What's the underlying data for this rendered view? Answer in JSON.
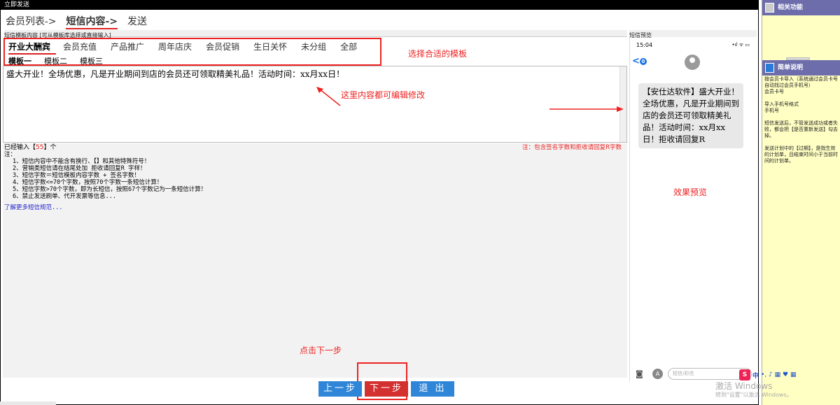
{
  "window": {
    "title": "立即发送"
  },
  "steps": [
    {
      "label": "会员列表->"
    },
    {
      "label": "短信内容->"
    },
    {
      "label": "发送"
    }
  ],
  "template_section": {
    "label": "短信模板内容   [可从模板库选择或直接输入]",
    "categories": [
      "开业大酬宾",
      "会员充值",
      "产品推广",
      "周年店庆",
      "会员促销",
      "生日关怀",
      "未分组",
      "全部"
    ],
    "subtabs": [
      "模板一",
      "模板二",
      "模板三"
    ],
    "annotation": "选择合适的模板"
  },
  "editor": {
    "content": "盛大开业！全场优惠，凡是开业期间到店的会员还可领取精美礼品！活动时间：xx月xx日！",
    "annotation": "这里内容都可编辑修改"
  },
  "notes": {
    "count_prefix": "已经输入【",
    "count_value": "55",
    "count_suffix": "】个",
    "hint": "注：包含签名字数和拒收请回复R字数",
    "title": "注：",
    "rules": [
      "1、短信内容中不能含有换行、【】和其他特殊符号！",
      "2、营销类短信请在结尾处加 拒收请回复R 字样！",
      "3、短信字数＝短信模板内容字数 + 签名字数！",
      "4、短信字数<=70个字数，按照70个字数一条短信计算！",
      "5、短信字数>70个字数，即为长短信，按照67个字数记为一条短信计算！",
      "6、禁止发送刷单、代开发票等信息..."
    ],
    "link": "了解更多短信规范..."
  },
  "preview": {
    "label": "短信预览",
    "time": "15:04",
    "status": "•ıl ᯤ ▭",
    "back": "<",
    "back_badge": "0",
    "message": "【安仕达软件】盛大开业！全场优惠，凡是开业期间到店的会员还可领取精美礼品！活动时间：xx月xx日！拒收请回复R",
    "annotation": "效果预览",
    "input_placeholder": "短信/彩信"
  },
  "footer_annotation": "点击下一步",
  "buttons": {
    "prev": "上一步",
    "next": "下一步",
    "exit": "退 出"
  },
  "right_panel": {
    "related_title": "相关功能",
    "help_title": "简单说明",
    "help_text": "按会员卡导入（系统通过会员卡号自动找过会员手机号）\n会员卡号\n\n导入手机号格式\n手机号\n\n短信发送后，不管发送成功或者失败，都会把【是否重新发送】勾去掉。\n\n发送计划中的【过期】，是指生效的计划单，且结束时间小于当前时间的计划单。"
  },
  "system": {
    "watermark": "激活 Windows",
    "watermark_sub": "转到\"设置\"以激活 Windows。",
    "ime_label": "中"
  },
  "colors": {
    "accent_red": "#e22222",
    "button_blue": "#2f86d8",
    "button_red": "#d43030",
    "help_panel": "#ffffc4"
  }
}
